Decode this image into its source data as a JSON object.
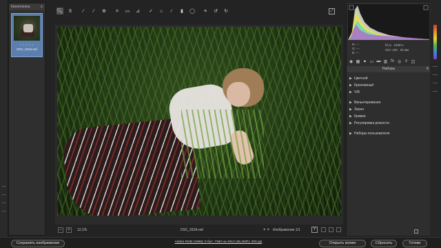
{
  "filmstrip": {
    "title": "Кинопленка",
    "stars": "• • • • •",
    "filename": "DSC_9154.nef"
  },
  "toolbar": {
    "tools": [
      "zoom-tool-icon",
      "hand-tool-icon",
      "white-balance-icon",
      "color-sampler-icon",
      "target-adjust-icon",
      "crop-icon",
      "straighten-icon",
      "transform-icon",
      "spot-removal-icon",
      "red-eye-icon",
      "adjustment-brush-icon",
      "graduated-filter-icon",
      "radial-filter-icon",
      "preferences-icon",
      "rotate-left-icon",
      "rotate-right-icon"
    ],
    "fullscreen": "fullscreen-icon"
  },
  "canvas": {
    "zoom_value": "12,1%",
    "filename": "DSC_9154.nef",
    "image_counter": "Изображение 1/1",
    "y_button": "Y"
  },
  "histogram": {
    "r_label": "R:",
    "g_label": "G:",
    "b_label": "B:",
    "r_value": "---",
    "g_value": "---",
    "b_value": "---",
    "aperture": "f/1,5",
    "shutter": "1/800 с",
    "iso": "ISO: 100",
    "focal": "25 мм"
  },
  "panel": {
    "title": "Наборы",
    "items": [
      {
        "label": "Цветной"
      },
      {
        "label": "Креативный"
      },
      {
        "label": "Ч/Б"
      },
      {
        "label": "Виньетирование"
      },
      {
        "label": "Зерно"
      },
      {
        "label": "Кривая"
      },
      {
        "label": "Регулировка резкости"
      },
      {
        "label": "Наборы пользователя"
      }
    ]
  },
  "bottom": {
    "save_label": "Сохранить изображение",
    "workflow_label": "Adobe RGB (1998); 8 бит; 7360 на 4912 (36,2МП); 300 ppi",
    "open_label": "Открыть копию",
    "reset_label": "Сбросить",
    "done_label": "Готово"
  },
  "colors": {
    "accent": "#5c7fae",
    "background": "#232323",
    "panel": "#2e2e2e"
  }
}
